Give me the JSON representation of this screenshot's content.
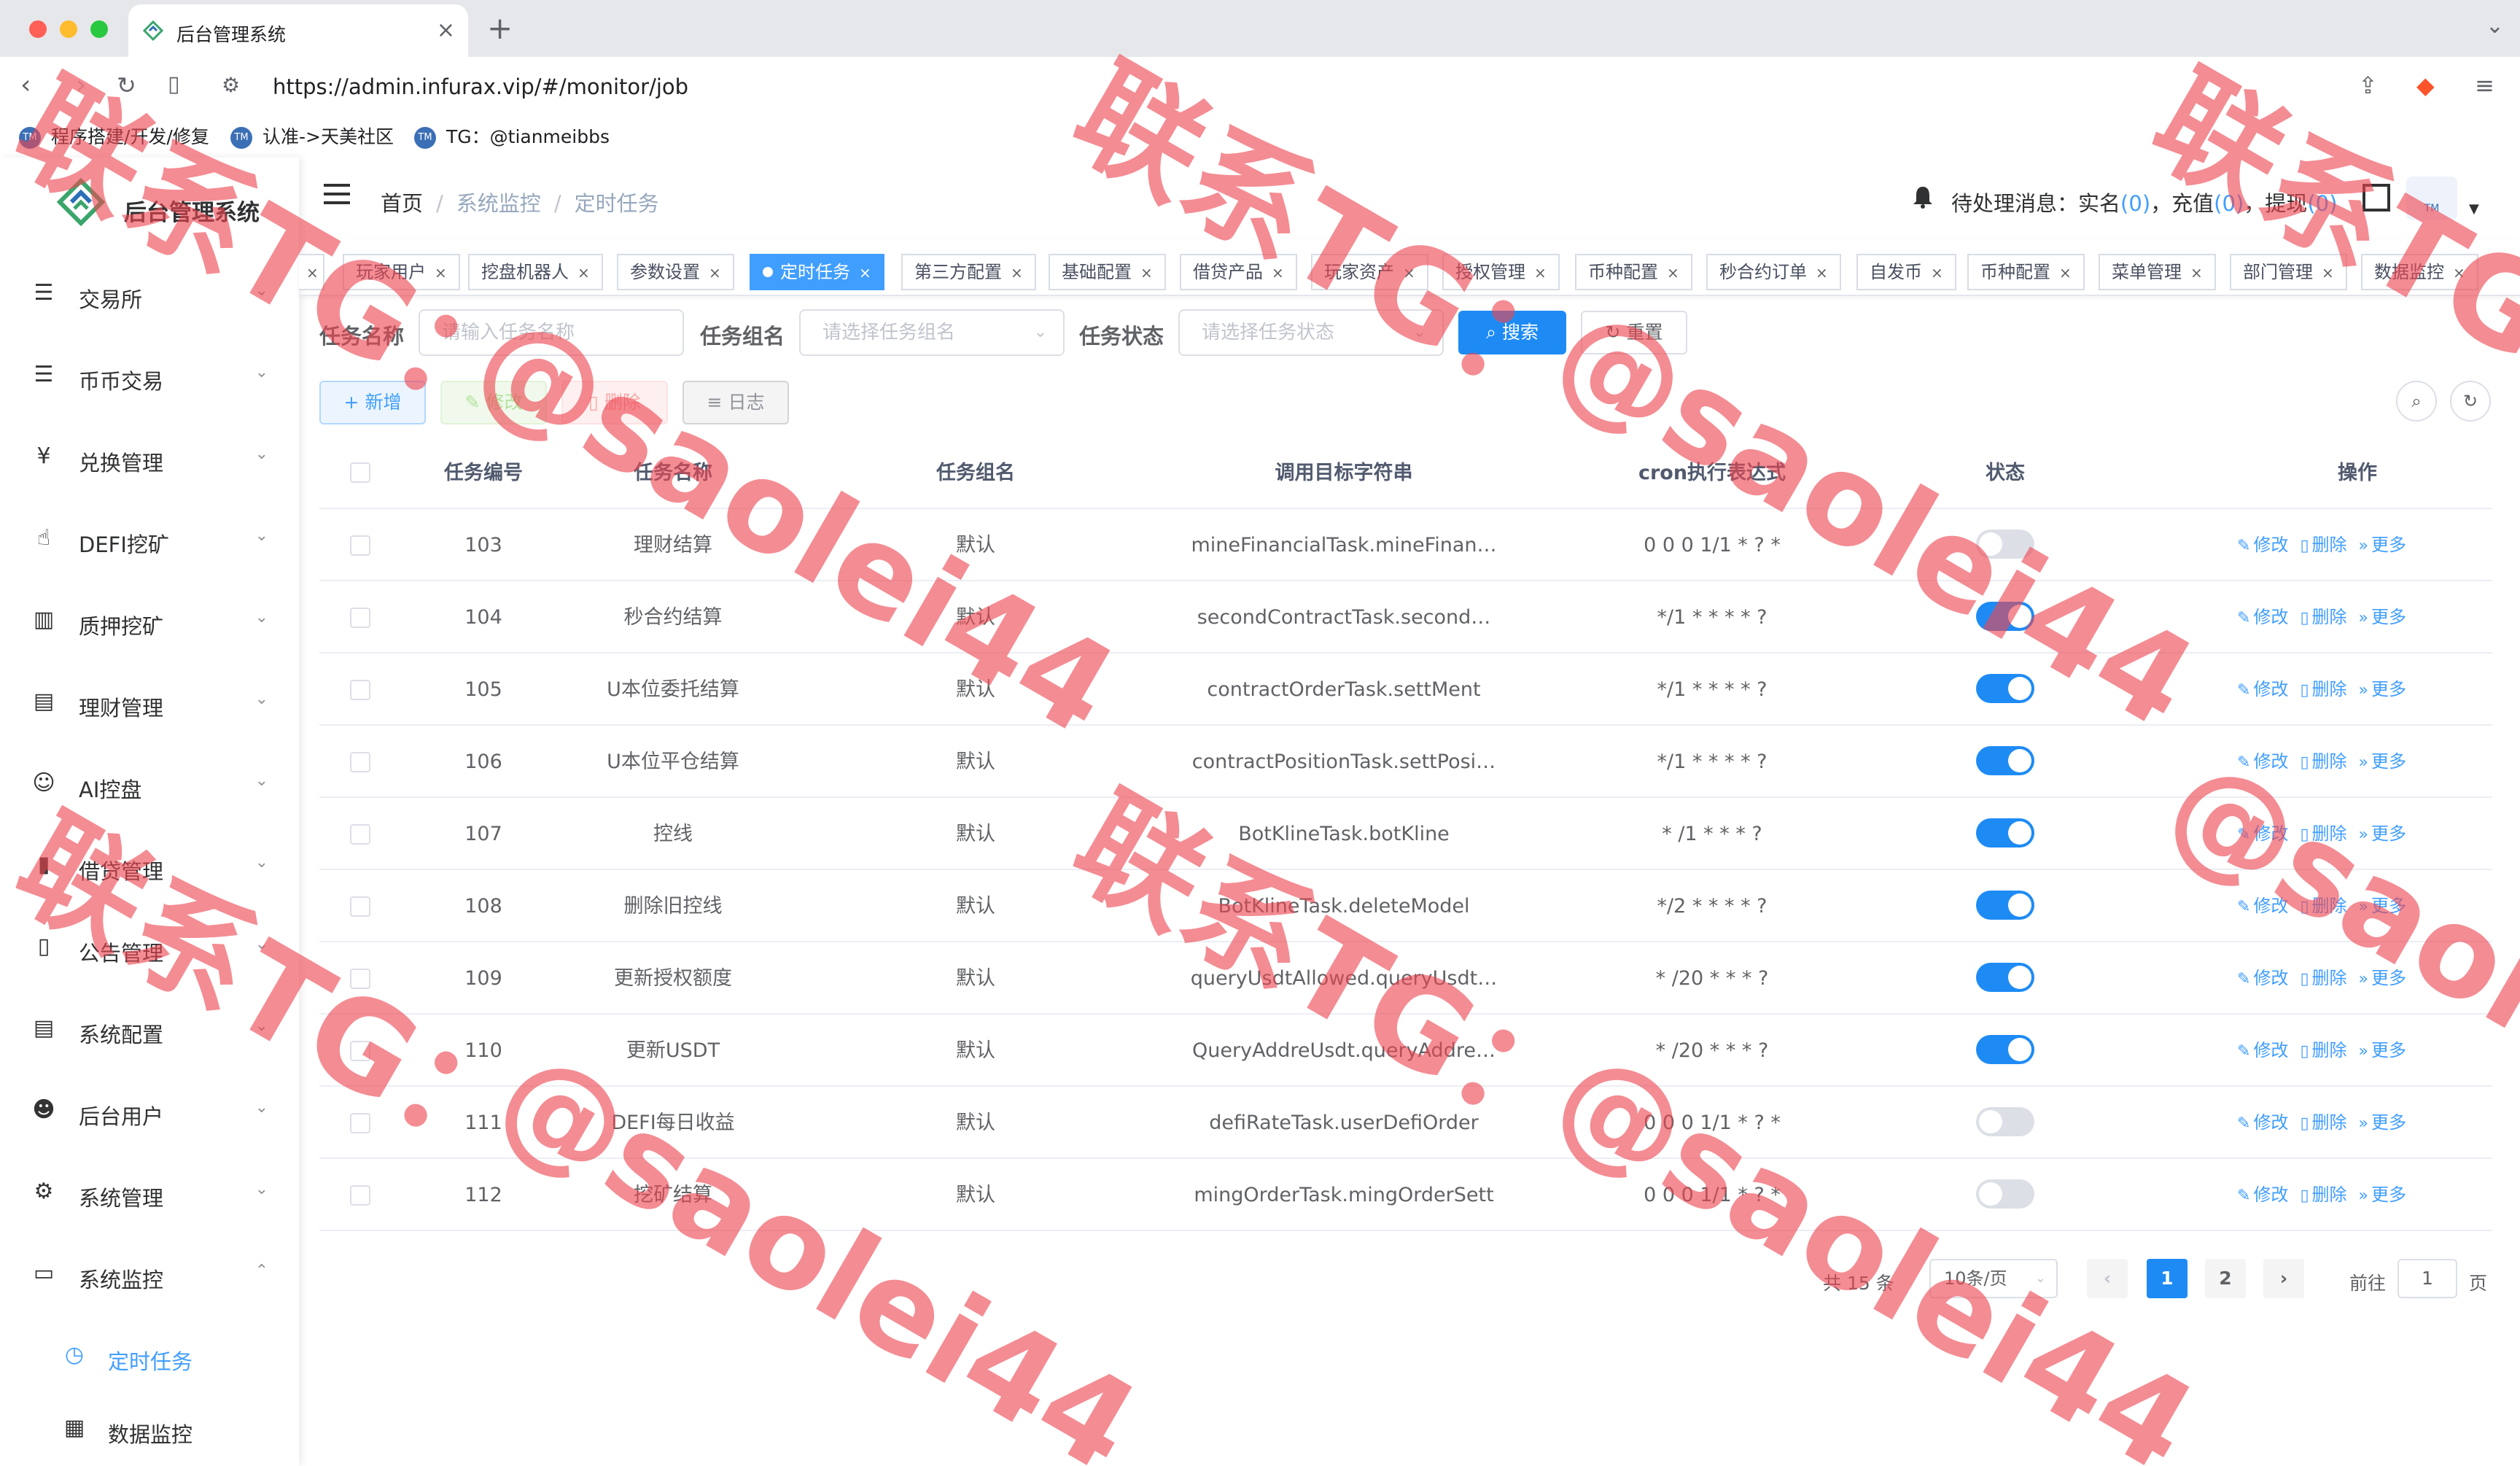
{
  "browser": {
    "tab_title": "后台管理系统",
    "url": "https://admin.infurax.vip/#/monitor/job",
    "bookmarks": [
      "程序搭建/开发/修复",
      "认准->天美社区",
      "TG：@tianmeibbs"
    ]
  },
  "app": {
    "logo_text": "后台管理系统",
    "breadcrumbs": [
      "首页",
      "系统监控",
      "定时任务"
    ],
    "notice": {
      "prefix": "待处理消息：",
      "items": [
        {
          "label": "实名",
          "count": "0"
        },
        {
          "label": "充值",
          "count": "0"
        },
        {
          "label": "提现",
          "count": "0"
        }
      ]
    }
  },
  "sidebar": {
    "items": [
      {
        "label": "交易所",
        "icon": "list-icon"
      },
      {
        "label": "币币交易",
        "icon": "list-icon"
      },
      {
        "label": "兑换管理",
        "icon": "yen-icon"
      },
      {
        "label": "DEFI挖矿",
        "icon": "hand-icon"
      },
      {
        "label": "质押挖矿",
        "icon": "bar-chart-icon"
      },
      {
        "label": "理财管理",
        "icon": "document-icon"
      },
      {
        "label": "AI控盘",
        "icon": "robot-icon"
      },
      {
        "label": "借贷管理",
        "icon": "book-icon"
      },
      {
        "label": "公告管理",
        "icon": "open-book-icon"
      },
      {
        "label": "系统配置",
        "icon": "document-icon"
      },
      {
        "label": "后台用户",
        "icon": "user-icon"
      },
      {
        "label": "系统管理",
        "icon": "gear-icon"
      },
      {
        "label": "系统监控",
        "icon": "monitor-icon"
      }
    ],
    "subitems": [
      {
        "label": "定时任务",
        "icon": "clock-icon",
        "active": true
      },
      {
        "label": "数据监控",
        "icon": "chart-icon",
        "active": false
      }
    ]
  },
  "tags": [
    "玩家用户",
    "挖盘机器人",
    "参数设置",
    "定时任务",
    "第三方配置",
    "基础配置",
    "借贷产品",
    "玩家资产",
    "授权管理",
    "币种配置",
    "秒合约订单",
    "自发币",
    "币种配置",
    "菜单管理",
    "部门管理",
    "数据监控"
  ],
  "active_tag": "定时任务",
  "search": {
    "name_label": "任务名称",
    "name_placeholder": "请输入任务名称",
    "group_label": "任务组名",
    "group_placeholder": "请选择任务组名",
    "status_label": "任务状态",
    "status_placeholder": "请选择任务状态",
    "search_button": "搜索",
    "reset_button": "重置"
  },
  "actions": {
    "add": "新增",
    "edit": "修改",
    "delete": "删除",
    "log": "日志"
  },
  "table": {
    "headers": [
      "任务编号",
      "任务名称",
      "任务组名",
      "调用目标字符串",
      "cron执行表达式",
      "状态",
      "操作"
    ],
    "rows": [
      {
        "id": "103",
        "name": "理财结算",
        "group": "默认",
        "target": "mineFinancialTask.mineFinan…",
        "cron": "0 0 0 1/1 * ? *",
        "enabled": false
      },
      {
        "id": "104",
        "name": "秒合约结算",
        "group": "默认",
        "target": "secondContractTask.second…",
        "cron": "*/1 * * * * ?",
        "enabled": true
      },
      {
        "id": "105",
        "name": "U本位委托结算",
        "group": "默认",
        "target": "contractOrderTask.settMent",
        "cron": "*/1 * * * * ?",
        "enabled": true
      },
      {
        "id": "106",
        "name": "U本位平仓结算",
        "group": "默认",
        "target": "contractPositionTask.settPosi…",
        "cron": "*/1 * * * * ?",
        "enabled": true
      },
      {
        "id": "107",
        "name": "控线",
        "group": "默认",
        "target": "BotKlineTask.botKline",
        "cron": "* /1 * * * ?",
        "enabled": true
      },
      {
        "id": "108",
        "name": "删除旧控线",
        "group": "默认",
        "target": "BotKlineTask.deleteModel",
        "cron": "*/2 * * * * ?",
        "enabled": true
      },
      {
        "id": "109",
        "name": "更新授权额度",
        "group": "默认",
        "target": "queryUsdtAllowed.queryUsdt…",
        "cron": "* /20 * * * ?",
        "enabled": true
      },
      {
        "id": "110",
        "name": "更新USDT",
        "group": "默认",
        "target": "QueryAddreUsdt.queryAddre…",
        "cron": "* /20 * * * ?",
        "enabled": true
      },
      {
        "id": "111",
        "name": "DEFI每日收益",
        "group": "默认",
        "target": "defiRateTask.userDefiOrder",
        "cron": "0 0 0 1/1 * ? *",
        "enabled": false
      },
      {
        "id": "112",
        "name": "挖矿结算",
        "group": "默认",
        "target": "mingOrderTask.mingOrderSett",
        "cron": "0 0 0 1/1 * ? *",
        "enabled": false
      }
    ],
    "row_ops": [
      "修改",
      "删除",
      "更多"
    ]
  },
  "pagination": {
    "total_text": "共 15 条",
    "page_size": "10条/页",
    "pages": [
      "1",
      "2"
    ],
    "current_page": "1",
    "goto_label": "前往",
    "goto_value": "1",
    "page_suffix": "页"
  },
  "watermark": {
    "texts": [
      "联系TG：",
      "@saolei44",
      "联系TG：",
      "@saolei44",
      "联系TG：",
      "@saolei44",
      "联系TG：",
      "@saolei44",
      "联系TG：",
      "@saolei44"
    ]
  },
  "colors": {
    "primary": "#1e8bf5",
    "link": "#409eff",
    "watermark": "#ee4650"
  }
}
